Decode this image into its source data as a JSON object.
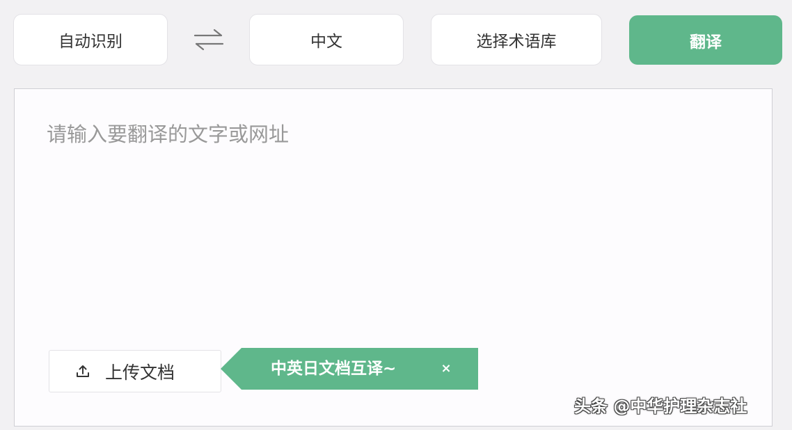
{
  "toolbar": {
    "source_lang": "自动识别",
    "target_lang": "中文",
    "glossary": "选择术语库",
    "translate": "翻译"
  },
  "editor": {
    "placeholder": "请输入要翻译的文字或网址",
    "value": ""
  },
  "upload": {
    "label": "上传文档"
  },
  "promo": {
    "text": "中英日文档互译~",
    "close": "×"
  },
  "watermark": {
    "text": "头条 @中华护理杂志社"
  },
  "icons": {
    "swap": "swap-arrows-icon",
    "upload": "upload-icon",
    "close": "close-icon"
  },
  "colors": {
    "accent": "#5fb78b",
    "background": "#f2f1f3",
    "placeholder": "#999999"
  }
}
